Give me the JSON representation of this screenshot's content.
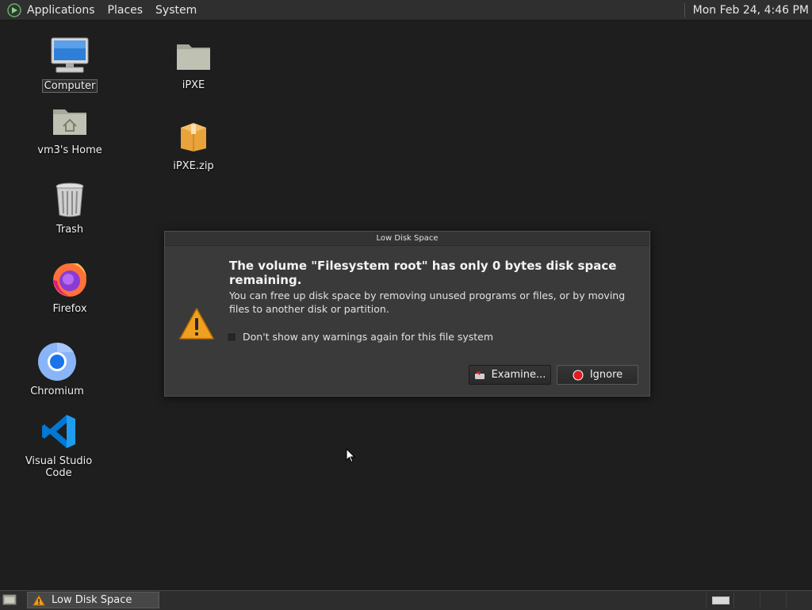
{
  "top_panel": {
    "menus": [
      "Applications",
      "Places",
      "System"
    ],
    "clock": "Mon Feb 24,  4:46 PM"
  },
  "desktop": {
    "icons": [
      {
        "label": "Computer",
        "icon": "computer-icon"
      },
      {
        "label": "vm3's Home",
        "icon": "home-folder-icon"
      },
      {
        "label": "Trash",
        "icon": "trash-icon"
      },
      {
        "label": "Firefox",
        "icon": "firefox-icon"
      },
      {
        "label": "Chromium",
        "icon": "chromium-icon"
      },
      {
        "label": "Visual Studio Code",
        "icon": "vscode-icon"
      },
      {
        "label": "iPXE",
        "icon": "folder-icon"
      },
      {
        "label": "iPXE.zip",
        "icon": "archive-icon"
      }
    ]
  },
  "dialog": {
    "title": "Low Disk Space",
    "heading": "The volume \"Filesystem root\" has only 0 bytes disk space remaining.",
    "body": "You can free up disk space by removing unused programs or files, or by moving files to another disk or partition.",
    "checkbox_label": "Don't show any warnings again for this file system",
    "checkbox_checked": false,
    "examine_label": "Examine...",
    "ignore_label": "Ignore",
    "icon": "warning-icon"
  },
  "taskbar": {
    "items": [
      {
        "label": "Low Disk Space",
        "icon": "warning-icon"
      }
    ]
  },
  "colors": {
    "desktop_bg": "#1e1e1e",
    "panel_bg": "#2f2f2f",
    "warning": "#f0a020",
    "ignore_red": "#e01b24"
  }
}
